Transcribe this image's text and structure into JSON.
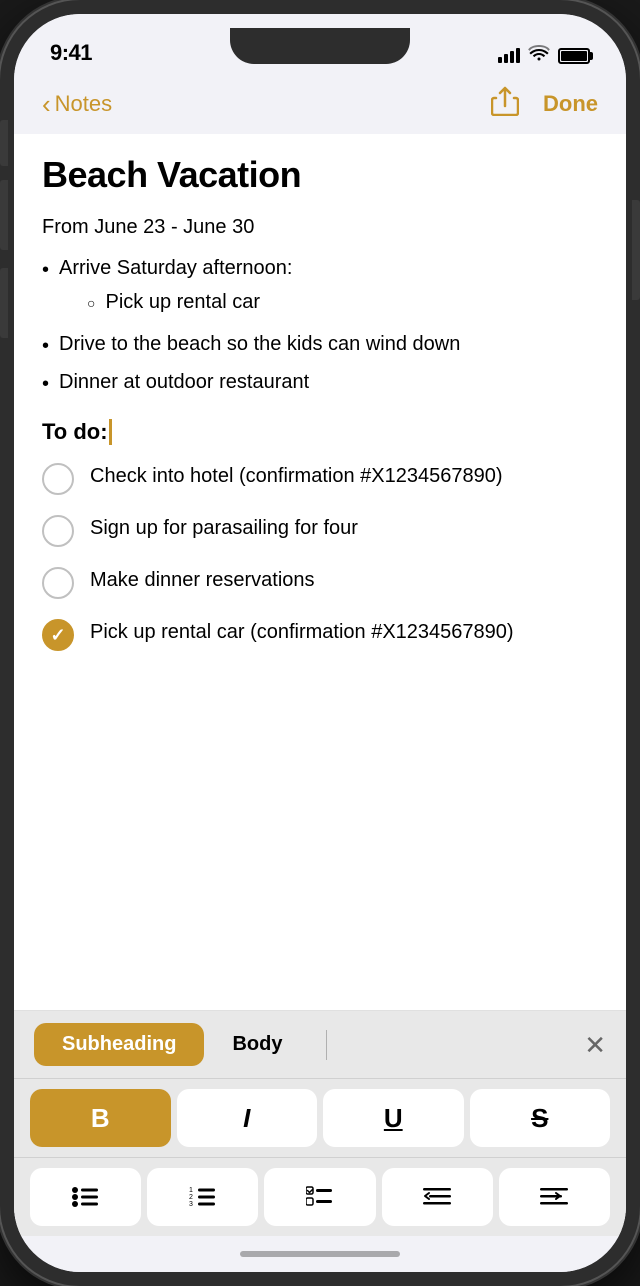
{
  "status_bar": {
    "time": "9:41"
  },
  "nav": {
    "back_label": "Notes",
    "done_label": "Done"
  },
  "note": {
    "title": "Beach Vacation",
    "date_line": "From June 23 - June 30",
    "bullet_items": [
      {
        "text": "Arrive Saturday afternoon:",
        "sub_items": [
          "Pick up rental car"
        ]
      },
      {
        "text": "Drive to the beach so the kids can wind down",
        "sub_items": []
      },
      {
        "text": "Dinner at outdoor restaurant",
        "sub_items": []
      }
    ],
    "todo_heading": "To do:",
    "todo_items": [
      {
        "text": "Check into hotel (confirmation #X1234567890)",
        "checked": false
      },
      {
        "text": "Sign up for parasailing for four",
        "checked": false
      },
      {
        "text": "Make dinner reservations",
        "checked": false
      },
      {
        "text": "Pick up rental car (confirmation #X1234567890)",
        "checked": true
      }
    ]
  },
  "toolbar": {
    "style_buttons": [
      "Subheading",
      "Body"
    ],
    "active_style": "Subheading",
    "text_styles": [
      "B",
      "I",
      "U",
      "S"
    ],
    "list_styles": [
      "bullet-list",
      "numbered-list",
      "checklist",
      "indent-left",
      "indent-right"
    ]
  },
  "accent_color": "#c8952a"
}
